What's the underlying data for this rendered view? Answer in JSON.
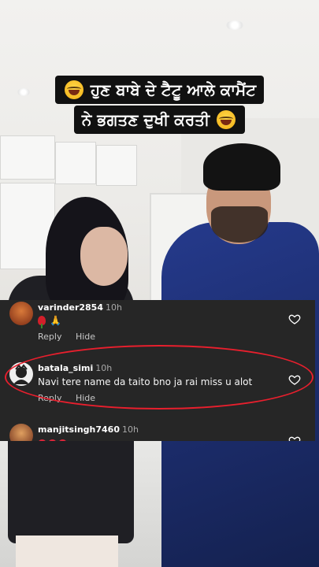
{
  "caption": {
    "line1": "ਹੁਣ ਬਾਬੇ ਦੇ ਟੈਟੂ ਆਲੇ ਕਾਮੈਂਟ",
    "line2": "ਨੇ ਭਗਤਣ ਦੁਖੀ ਕਰਤੀ",
    "emoji": "face-with-tears-of-joy"
  },
  "comments": [
    {
      "username": "varinder2854",
      "time": "10h",
      "text_emojis": [
        "rose",
        "folded-hands"
      ],
      "reply_label": "Reply",
      "hide_label": "Hide"
    },
    {
      "username": "batala_simi",
      "time": "10h",
      "text": "Navi tere name da taito bno ja rai miss u alot",
      "reply_label": "Reply",
      "hide_label": "Hide",
      "highlighted": true
    },
    {
      "username": "manjitsingh7460",
      "time": "10h",
      "text_emojis": [
        "red-heart",
        "red-heart",
        "red-heart"
      ]
    }
  ],
  "colors": {
    "overlay_bg": "#262626",
    "highlight": "#e81f2d",
    "blanket": "#1d2e70"
  }
}
